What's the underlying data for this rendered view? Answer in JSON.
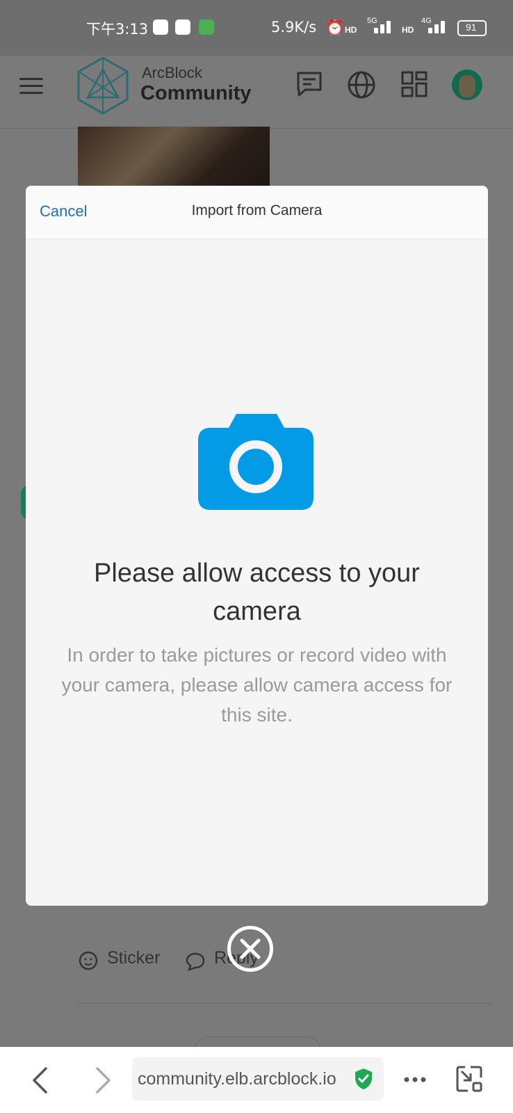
{
  "status_bar": {
    "time": "下午3:13",
    "net_speed": "5.9K/s",
    "network_5g": "5G",
    "network_4g": "4G",
    "hd_label": "HD",
    "battery": "91"
  },
  "header": {
    "brand_top": "ArcBlock",
    "brand_bottom": "Community"
  },
  "modal": {
    "cancel_label": "Cancel",
    "title": "Import from Camera",
    "headline": "Please allow access to your camera",
    "description": "In order to take pictures or record video with your camera, please allow camera access for this site."
  },
  "post_actions": {
    "sticker_label": "Sticker",
    "reply_label": "Reply"
  },
  "browser": {
    "url": "community.elb.arcblock.io"
  },
  "colors": {
    "accent": "#039be5",
    "link": "#1f6fae",
    "secure_green": "#1eaa55"
  }
}
